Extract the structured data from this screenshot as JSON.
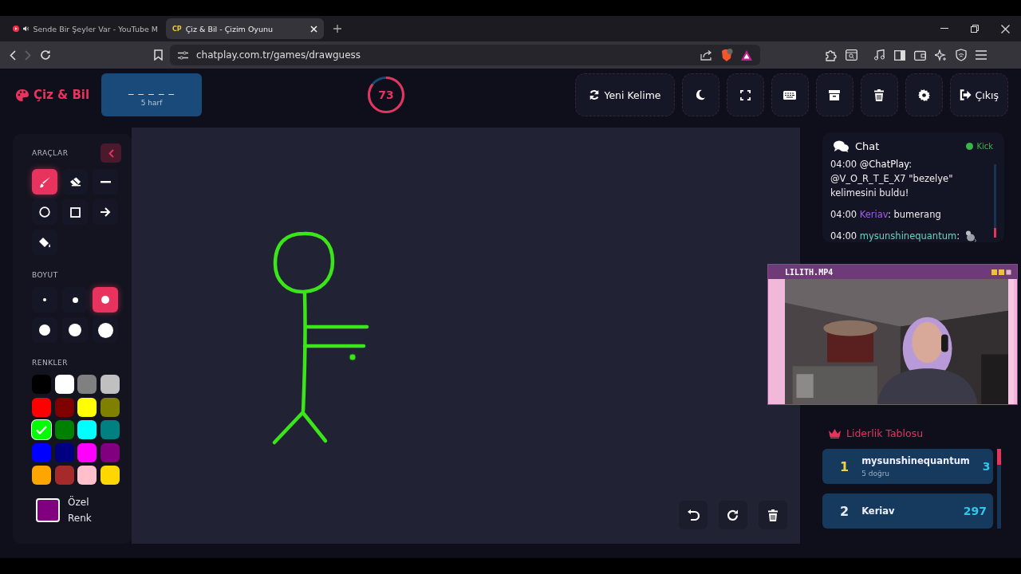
{
  "browser": {
    "tabs": [
      {
        "title": "Sende Bir Şeyler Var - YouTube M",
        "audio": true,
        "selected": false
      },
      {
        "title": "Çiz & Bil - Çizim Oyunu",
        "favicon": "CP",
        "audio": false,
        "selected": true
      }
    ],
    "url": "chatplay.com.tr/games/drawguess"
  },
  "header": {
    "logo": "Çiz & Bil",
    "word_mask": "_ _ _ _ _",
    "word_hint": "5 harf",
    "timer": {
      "value": "73"
    },
    "buttons": [
      {
        "kind": "refresh",
        "label": "Yeni Kelime"
      },
      {
        "kind": "moon"
      },
      {
        "kind": "fullscreen"
      },
      {
        "kind": "keyboard"
      },
      {
        "kind": "archive"
      },
      {
        "kind": "trash"
      },
      {
        "kind": "gear"
      },
      {
        "kind": "logout",
        "label": "Çıkış"
      }
    ]
  },
  "tools": {
    "title": "ARAÇLAR",
    "items": [
      {
        "kind": "brush",
        "selected": true
      },
      {
        "kind": "eraser",
        "selected": false
      },
      {
        "kind": "line",
        "selected": false
      },
      {
        "kind": "circle",
        "selected": false
      },
      {
        "kind": "rect",
        "selected": false
      },
      {
        "kind": "arrow",
        "selected": false
      },
      {
        "kind": "fill",
        "selected": false
      }
    ]
  },
  "sizes": {
    "title": "BOYUT",
    "items": [
      {
        "selected": false
      },
      {
        "selected": false
      },
      {
        "selected": true
      },
      {
        "selected": false
      },
      {
        "selected": false
      },
      {
        "selected": false
      }
    ]
  },
  "colors": {
    "title": "RENKLER",
    "items": [
      {
        "color": "#000000",
        "selected": false
      },
      {
        "color": "#ffffff",
        "selected": false
      },
      {
        "color": "#808080",
        "selected": false
      },
      {
        "color": "#c0c0c0",
        "selected": false
      },
      {
        "color": "#ff0000",
        "selected": false
      },
      {
        "color": "#800000",
        "selected": false
      },
      {
        "color": "#ffff00",
        "selected": false
      },
      {
        "color": "#808000",
        "selected": false
      },
      {
        "color": "#00ff00",
        "selected": true
      },
      {
        "color": "#008000",
        "selected": false
      },
      {
        "color": "#00ffff",
        "selected": false
      },
      {
        "color": "#008080",
        "selected": false
      },
      {
        "color": "#0000ff",
        "selected": false
      },
      {
        "color": "#000080",
        "selected": false
      },
      {
        "color": "#ff00ff",
        "selected": false
      },
      {
        "color": "#800080",
        "selected": false
      },
      {
        "color": "#ffa500",
        "selected": false
      },
      {
        "color": "#a52a2a",
        "selected": false
      },
      {
        "color": "#ffc0cb",
        "selected": false
      },
      {
        "color": "#ffd700",
        "selected": false
      }
    ],
    "custom": {
      "label": "Özel Renk",
      "color": "#800080"
    }
  },
  "chat": {
    "title": "Chat",
    "source": "Kick",
    "messages": [
      {
        "time": "04:00",
        "user": "@ChatPlay",
        "color": "#ffffff",
        "text": ": @V_O_R_T_E_X7 \"bezelye\" kelimesini buldu!"
      },
      {
        "time": "04:00",
        "user": "Keriav",
        "color": "#a35cf0",
        "text": ": bumerang"
      },
      {
        "time": "04:00",
        "user": "mysunshinequantum",
        "color": "#5fd8c0",
        "text": ":",
        "sticker": true
      }
    ]
  },
  "video": {
    "title": "LILITH.MP4",
    "kind": "picture"
  },
  "leaderboard": {
    "title": "Liderlik Tablosu",
    "entries": [
      {
        "rank": "1",
        "name": "mysunshinequantum",
        "detail": "5 doğru",
        "score": "3"
      },
      {
        "rank": "2",
        "name": "Keriav",
        "score": "297"
      }
    ]
  }
}
